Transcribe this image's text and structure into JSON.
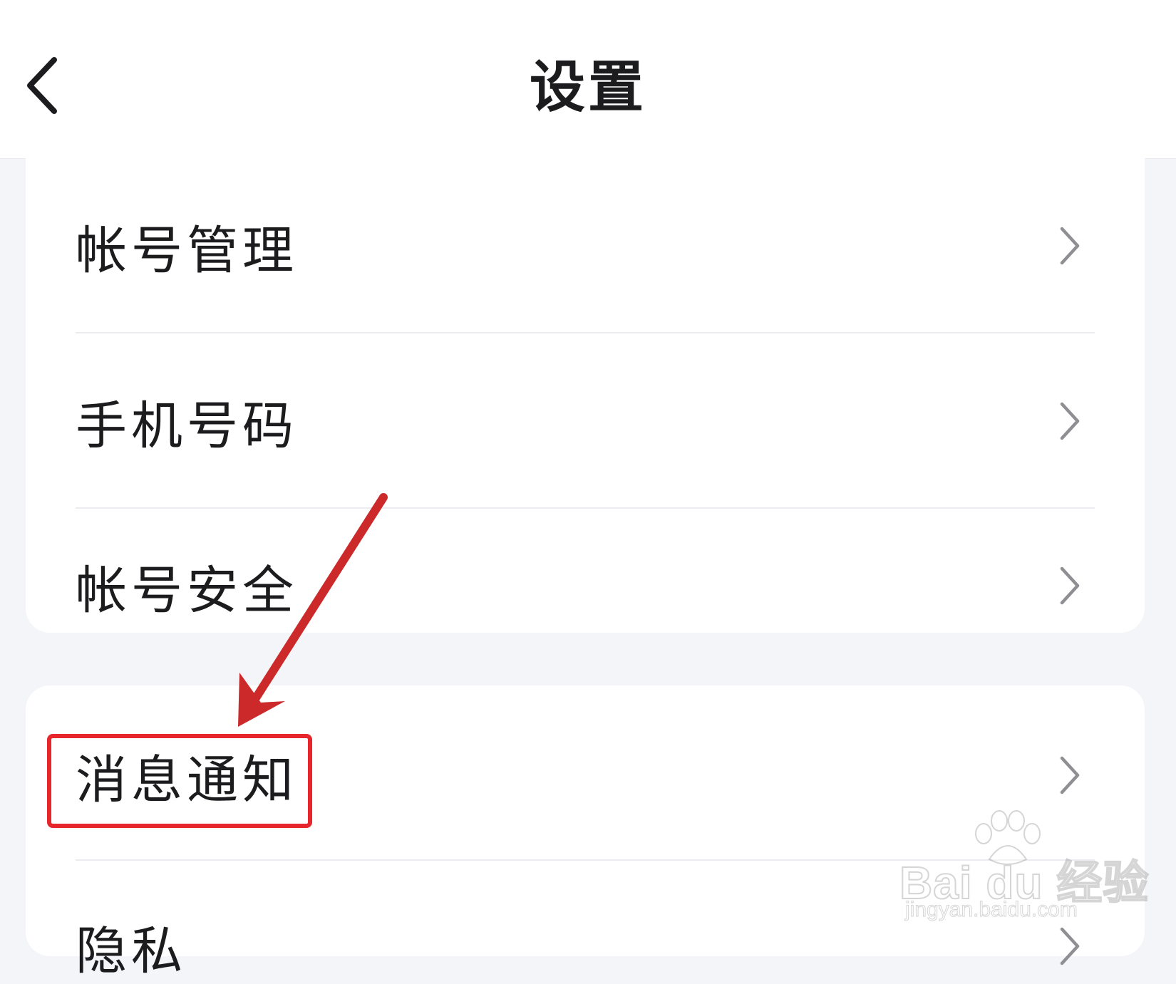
{
  "header": {
    "title": "设置",
    "back_icon": "chevron-left-icon"
  },
  "groups": [
    {
      "items": [
        {
          "label": "帐号管理"
        },
        {
          "label": "手机号码"
        },
        {
          "label": "帐号安全"
        }
      ]
    },
    {
      "items": [
        {
          "label": "消息通知"
        },
        {
          "label": "隐私"
        }
      ]
    }
  ],
  "annotation": {
    "highlighted_item": "消息通知",
    "color": "#e6262b"
  },
  "watermark": {
    "brand": "Bai du 经验",
    "url": "jingyan.baidu.com"
  },
  "colors": {
    "background": "#f4f5f9",
    "card": "#ffffff",
    "text": "#1c1c1e",
    "chevron": "#8e8e93",
    "divider": "#ececf0"
  }
}
